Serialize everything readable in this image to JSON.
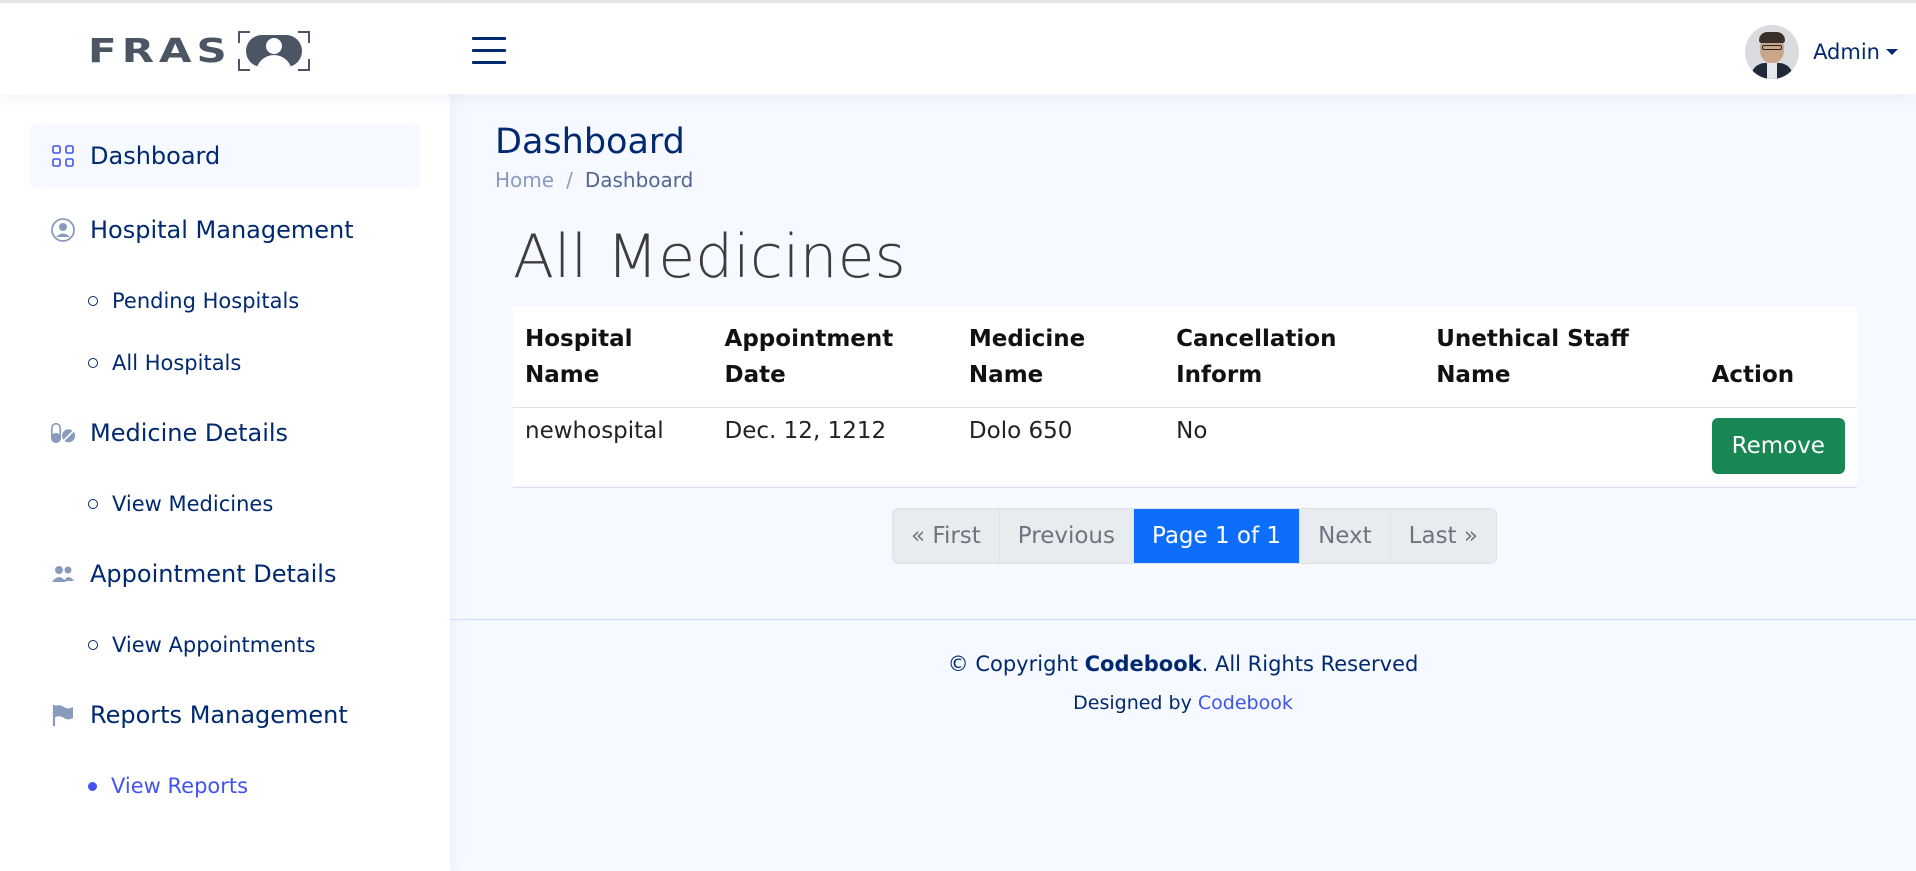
{
  "header": {
    "logo_text": "FRAS",
    "profile_name": "Admin"
  },
  "sidebar": {
    "items": [
      {
        "label": "Dashboard",
        "icon": "grid-icon"
      },
      {
        "label": "Hospital Management",
        "icon": "person-circle-icon"
      },
      {
        "label": "Pending Hospitals"
      },
      {
        "label": "All Hospitals"
      },
      {
        "label": "Medicine Details",
        "icon": "capsule-icon"
      },
      {
        "label": "View Medicines"
      },
      {
        "label": "Appointment Details",
        "icon": "people-icon"
      },
      {
        "label": "View Appointments"
      },
      {
        "label": "Reports Management",
        "icon": "flag-icon"
      },
      {
        "label": "View Reports"
      }
    ]
  },
  "page": {
    "title": "Dashboard",
    "breadcrumb": {
      "home": "Home",
      "separator": "/",
      "current": "Dashboard"
    }
  },
  "section_title": "All Medicines",
  "table": {
    "headers": [
      {
        "line1": "Hospital",
        "line2": "Name"
      },
      {
        "line1": "Appointment",
        "line2": "Date"
      },
      {
        "line1": "Medicine",
        "line2": "Name"
      },
      {
        "line1": "Cancellation",
        "line2": "Inform"
      },
      {
        "line1": "Unethical Staff",
        "line2": "Name"
      },
      {
        "line1": "",
        "line2": "Action"
      }
    ],
    "rows": [
      {
        "hospital": "newhospital",
        "date": "Dec. 12, 1212",
        "medicine": "Dolo 650",
        "cancellation": "No",
        "staff": "",
        "action": "Remove"
      }
    ]
  },
  "pagination": {
    "first": "« First",
    "previous": "Previous",
    "current": "Page 1 of 1",
    "next": "Next",
    "last": "Last »"
  },
  "footer": {
    "copyright_prefix": "© Copyright",
    "brand": "Codebook",
    "copyright_suffix": ". All Rights Reserved",
    "designed_by": "Designed by",
    "designer": "Codebook"
  },
  "colors": {
    "primary": "#012970",
    "accent": "#4154f1",
    "success": "#198754",
    "page_active": "#0d6efd",
    "background": "#f6f9ff"
  }
}
